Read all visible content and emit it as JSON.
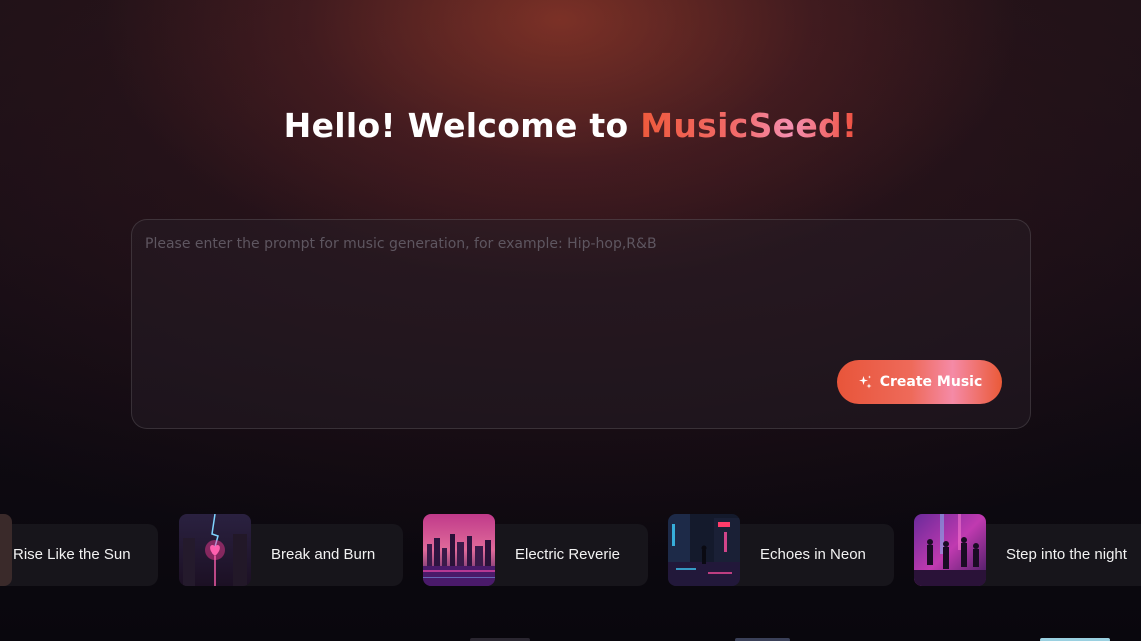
{
  "header": {
    "greeting": "Hello! Welcome to ",
    "brand": "MusicSeed!"
  },
  "prompt": {
    "placeholder": "Please enter the prompt for music generation, for example: Hip-hop,R&B",
    "value": ""
  },
  "create_button": {
    "label": "Create Music",
    "icon": "sparkle-icon"
  },
  "tracks": [
    {
      "title": "Rise Like the Sun"
    },
    {
      "title": "Break and Burn"
    },
    {
      "title": "Electric Reverie"
    },
    {
      "title": "Echoes in Neon"
    },
    {
      "title": "Step into the night"
    }
  ],
  "colors": {
    "accent_start": "#e8553a",
    "accent_mid": "#f58aa6",
    "background": "#0a0810"
  }
}
